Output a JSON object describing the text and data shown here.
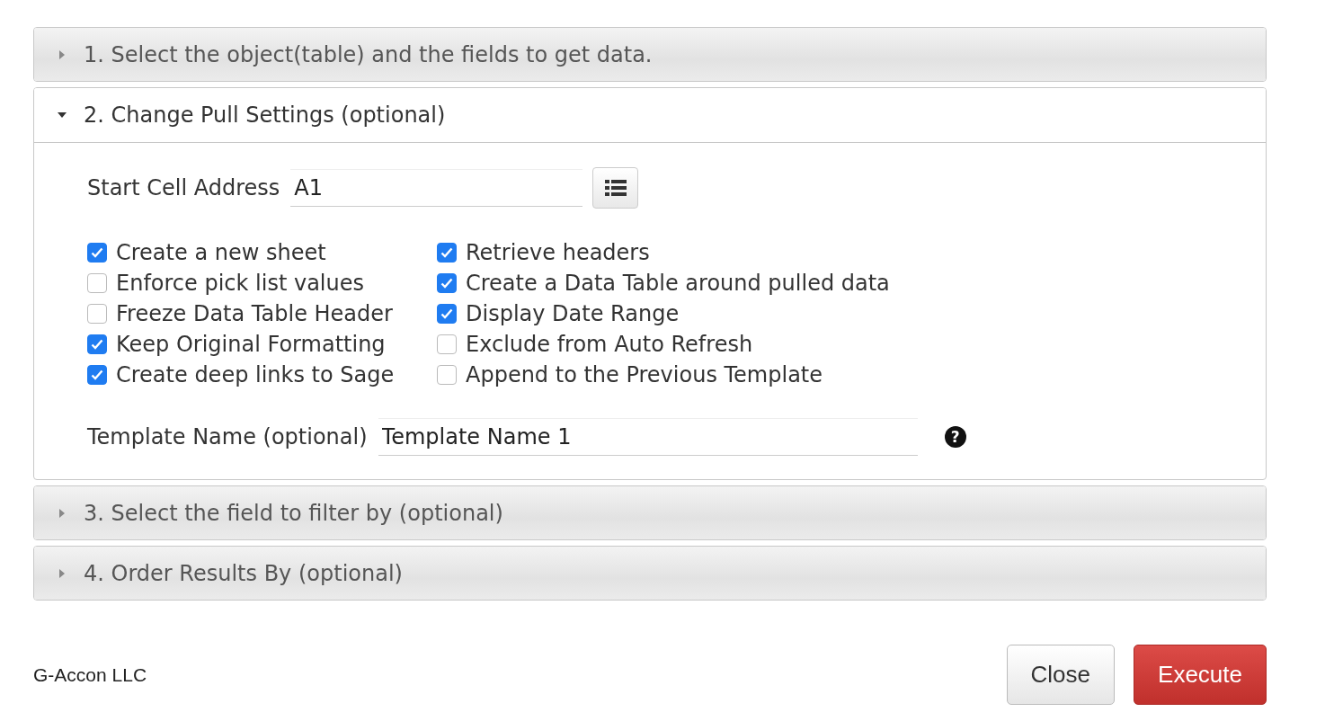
{
  "sections": [
    {
      "title": "1. Select the object(table) and the fields to get data.",
      "expanded": false
    },
    {
      "title": "2. Change Pull Settings (optional)",
      "expanded": true
    },
    {
      "title": "3. Select the field to filter by (optional)",
      "expanded": false
    },
    {
      "title": "4. Order Results By (optional)",
      "expanded": false
    }
  ],
  "pull_settings": {
    "start_cell": {
      "label": "Start Cell Address",
      "value": "A1"
    },
    "options": [
      [
        {
          "label": "Create a new sheet",
          "checked": true
        },
        {
          "label": "Enforce pick list values",
          "checked": false
        },
        {
          "label": "Freeze Data Table Header",
          "checked": false
        },
        {
          "label": "Keep Original Formatting",
          "checked": true
        },
        {
          "label": "Create deep links to Sage",
          "checked": true
        }
      ],
      [
        {
          "label": "Retrieve headers",
          "checked": true
        },
        {
          "label": "Create a Data Table around pulled data",
          "checked": true
        },
        {
          "label": "Display Date Range",
          "checked": true
        },
        {
          "label": "Exclude from Auto Refresh",
          "checked": false
        },
        {
          "label": "Append to the Previous Template",
          "checked": false
        }
      ]
    ],
    "template_name": {
      "label": "Template Name (optional)",
      "value": "Template Name 1",
      "help": "?"
    }
  },
  "footer": {
    "company": "G-Accon LLC",
    "buttons": [
      {
        "label": "Close",
        "kind": "default"
      },
      {
        "label": "Execute",
        "kind": "danger"
      }
    ]
  }
}
